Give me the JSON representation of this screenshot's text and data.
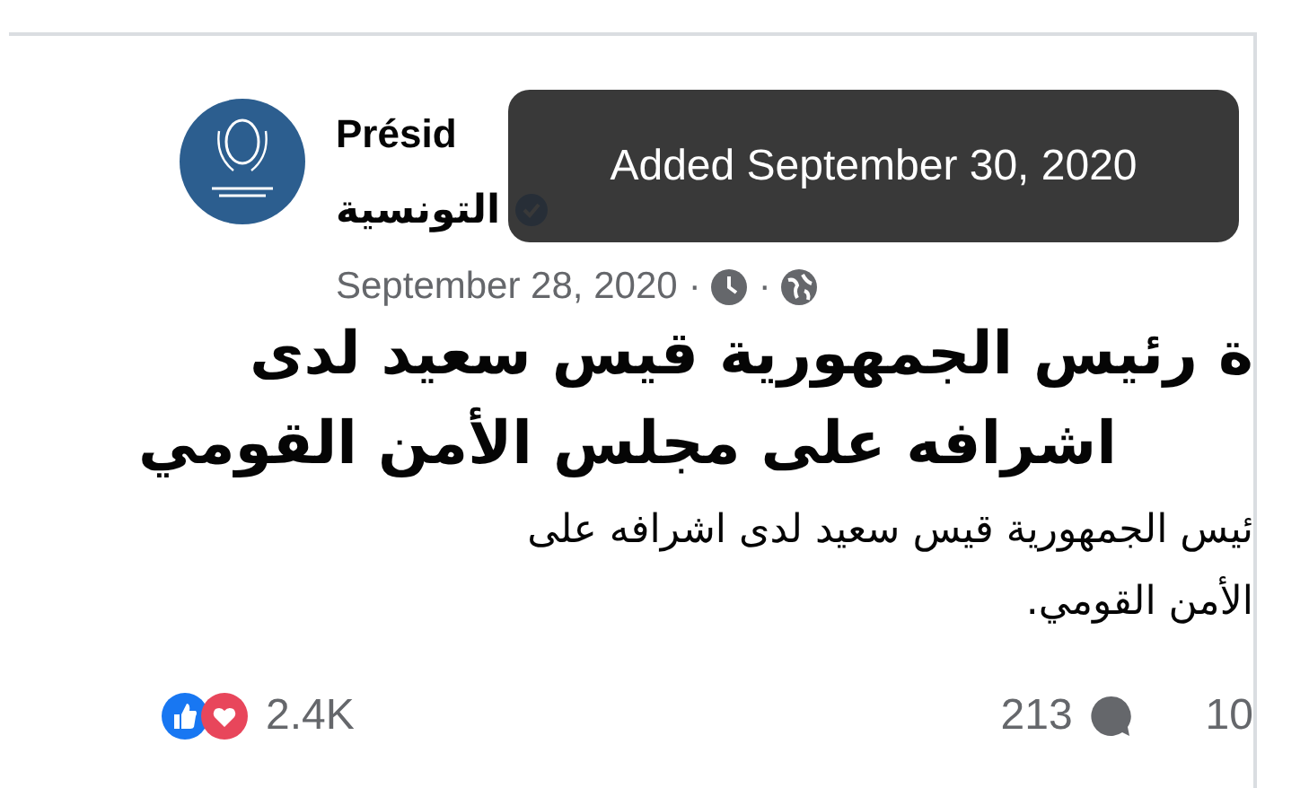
{
  "post": {
    "author_name": "Présid",
    "author_name_line_2": "التونسية",
    "verified": true,
    "date": "September 28, 2020",
    "separator_1": "·",
    "separator_2": "·",
    "headline_lines": [
      "ة رئيس الجمهورية قيس سعيد لدى",
      "اشرافه على مجلس الأمن القومي"
    ],
    "body_lines": [
      "ئيس الجمهورية قيس سعيد لدى اشرافه على",
      "الأمن القومي."
    ],
    "reactions_count": "2.4K",
    "comments_count": "213",
    "shares_count": "10"
  },
  "tooltip": {
    "text": "Added September 30, 2020"
  }
}
